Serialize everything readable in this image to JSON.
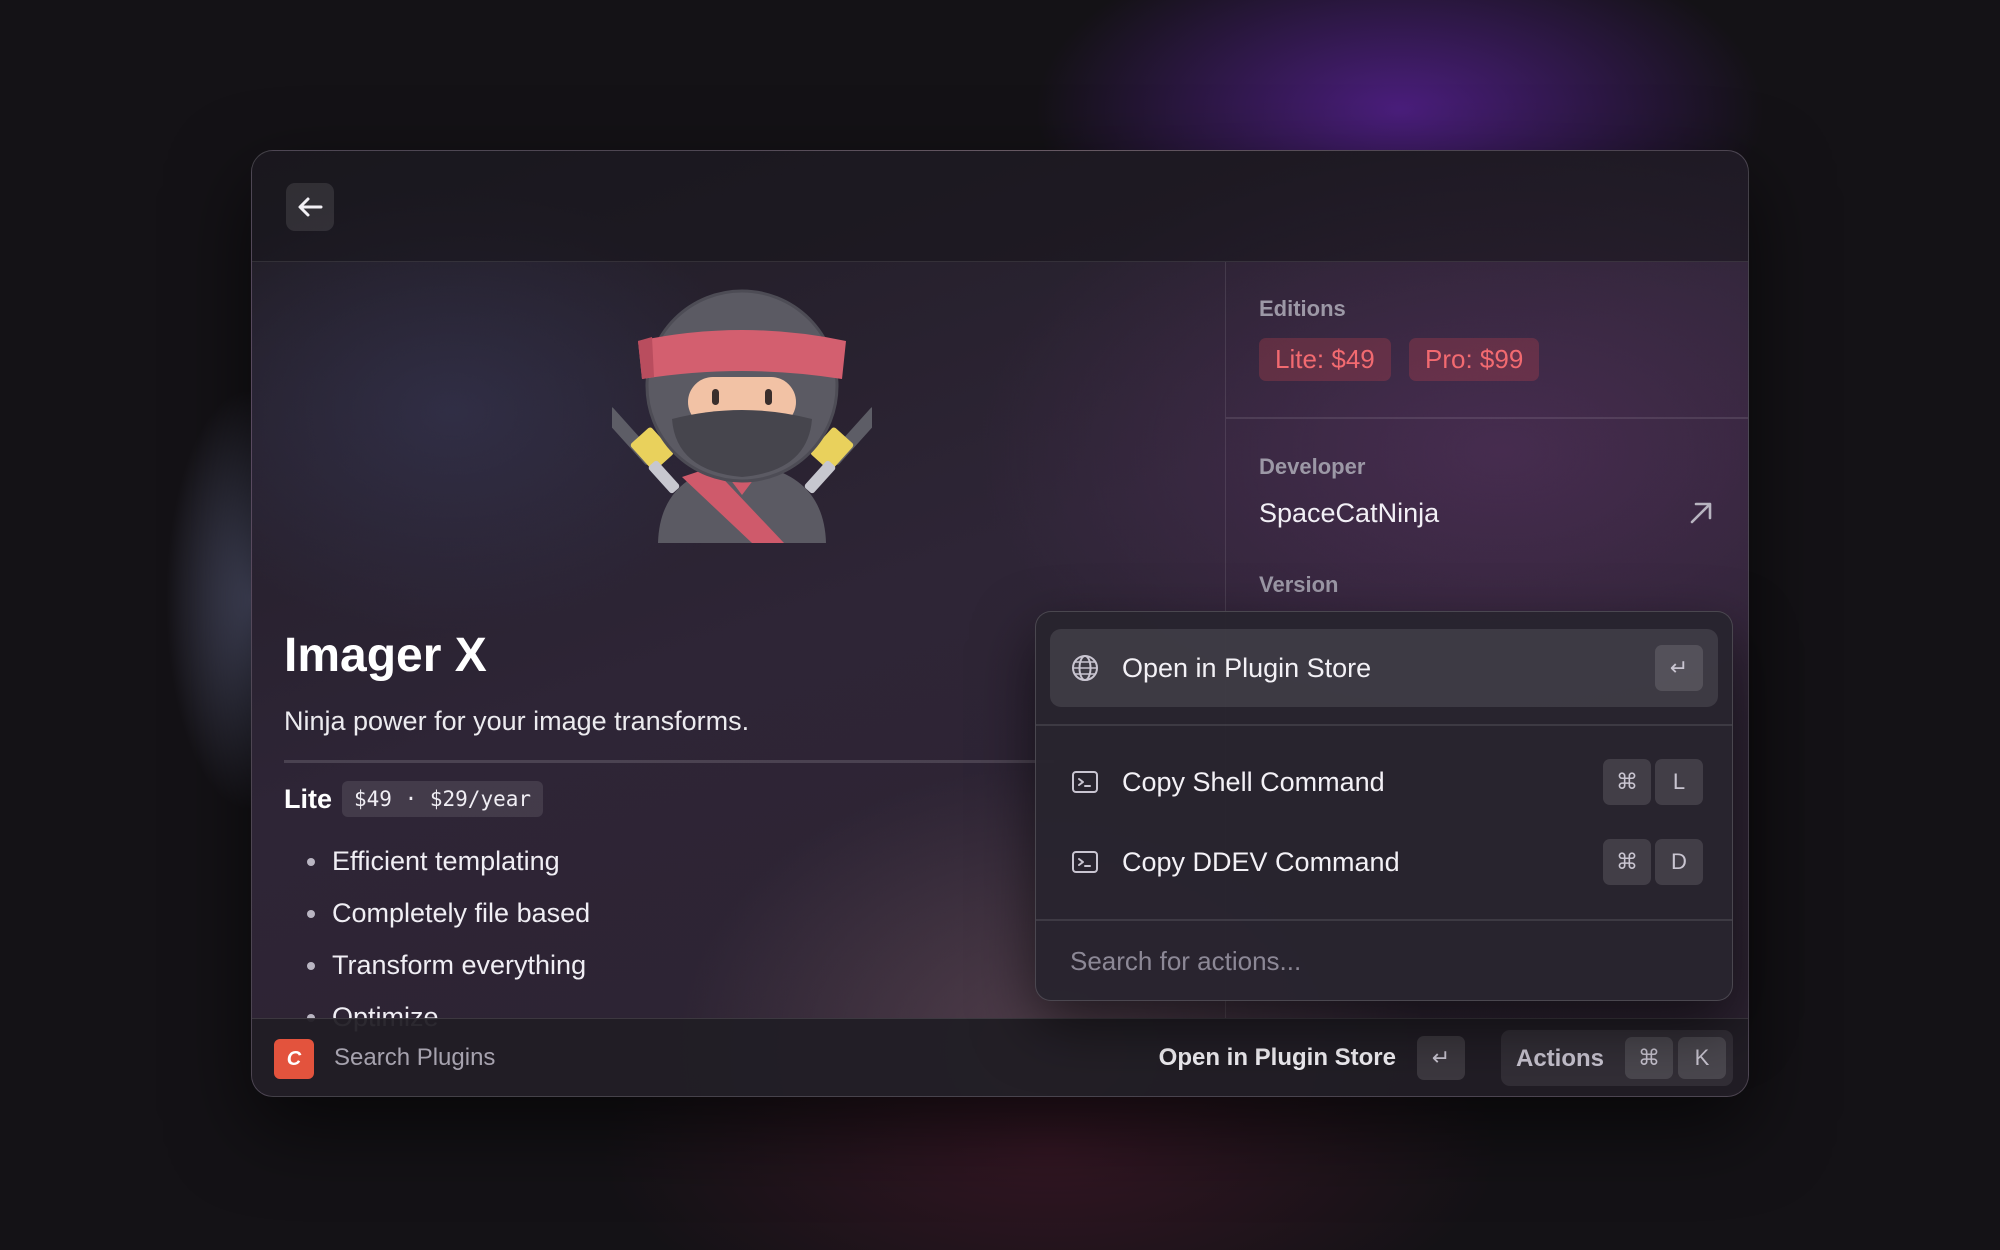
{
  "plugin": {
    "name": "Imager X",
    "tagline": "Ninja power for your image transforms.",
    "lite_label": "Lite",
    "lite_price": "$49 · $29/year",
    "features": [
      "Efficient templating",
      "Completely file based",
      "Transform everything",
      "Optimize"
    ]
  },
  "sidebar": {
    "editions_title": "Editions",
    "editions": [
      "Lite: $49",
      "Pro: $99"
    ],
    "developer_title": "Developer",
    "developer_name": "SpaceCatNinja",
    "version_title": "Version"
  },
  "action_menu": {
    "items": [
      {
        "label": "Open in Plugin Store",
        "icon": "globe-icon",
        "keys": [
          "↵"
        ]
      },
      {
        "label": "Copy Shell Command",
        "icon": "terminal-icon",
        "keys": [
          "⌘",
          "L"
        ]
      },
      {
        "label": "Copy DDEV Command",
        "icon": "terminal-icon",
        "keys": [
          "⌘",
          "D"
        ]
      }
    ],
    "search_placeholder": "Search for actions..."
  },
  "statusbar": {
    "app_icon_letter": "C",
    "search_label": "Search Plugins",
    "primary_action": "Open in Plugin Store",
    "primary_key": "↵",
    "actions_label": "Actions",
    "actions_keys": [
      "⌘",
      "K"
    ]
  },
  "colors": {
    "accent_red": "#f26a70",
    "app_icon": "#e3533d"
  }
}
